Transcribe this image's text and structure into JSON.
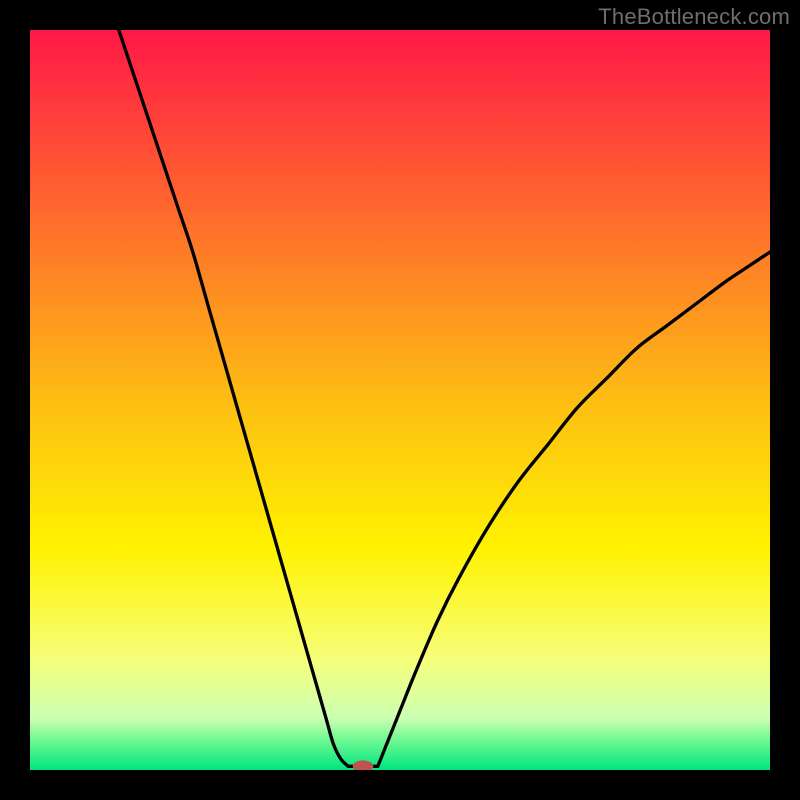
{
  "watermark": "TheBottleneck.com",
  "chart_data": {
    "type": "line",
    "title": "",
    "xlabel": "",
    "ylabel": "",
    "xlim": [
      0,
      100
    ],
    "ylim": [
      0,
      100
    ],
    "grid": false,
    "legend": false,
    "annotations": [],
    "background_gradient": {
      "stops": [
        {
          "offset": 0.0,
          "color": "#ff1846"
        },
        {
          "offset": 0.25,
          "color": "#ff6b2c"
        },
        {
          "offset": 0.5,
          "color": "#fdbd13"
        },
        {
          "offset": 0.7,
          "color": "#fff200"
        },
        {
          "offset": 0.85,
          "color": "#f6ff7a"
        },
        {
          "offset": 0.93,
          "color": "#ccffb2"
        },
        {
          "offset": 0.96,
          "color": "#6ef892"
        },
        {
          "offset": 1.0,
          "color": "#00e57e"
        }
      ]
    },
    "series": [
      {
        "name": "bottleneck-curve-left",
        "x": [
          12,
          14,
          16,
          18,
          20,
          22,
          24,
          26,
          28,
          30,
          32,
          34,
          36,
          38,
          40,
          41,
          42,
          43
        ],
        "y": [
          100,
          94,
          88,
          82,
          76,
          70,
          63,
          56,
          49,
          42,
          35,
          28,
          21,
          14,
          7,
          3.5,
          1.5,
          0.5
        ]
      },
      {
        "name": "bottleneck-curve-flat",
        "x": [
          43,
          47
        ],
        "y": [
          0.5,
          0.5
        ]
      },
      {
        "name": "bottleneck-curve-right",
        "x": [
          47,
          48,
          50,
          52,
          55,
          58,
          62,
          66,
          70,
          74,
          78,
          82,
          86,
          90,
          94,
          97,
          100
        ],
        "y": [
          0.5,
          3,
          8,
          13,
          20,
          26,
          33,
          39,
          44,
          49,
          53,
          57,
          60,
          63,
          66,
          68,
          70
        ]
      }
    ],
    "marker": {
      "name": "optimal-point",
      "x": 45,
      "y": 0.5,
      "color": "#c0524f",
      "rx": 1.4,
      "ry": 0.8
    }
  }
}
